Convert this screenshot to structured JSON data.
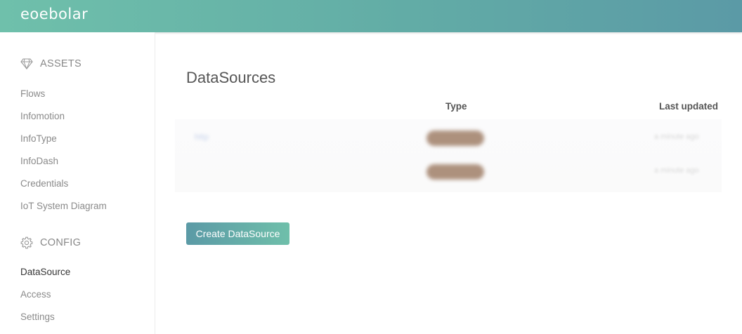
{
  "header": {
    "logo_text": "eoebolar"
  },
  "sidebar": {
    "assets_heading": "ASSETS",
    "assets_items": [
      {
        "label": "Flows"
      },
      {
        "label": "Infomotion"
      },
      {
        "label": "InfoType"
      },
      {
        "label": "InfoDash"
      },
      {
        "label": "Credentials"
      },
      {
        "label": "IoT System Diagram"
      }
    ],
    "config_heading": "CONFIG",
    "config_items": [
      {
        "label": "DataSource",
        "active": true
      },
      {
        "label": "Access"
      },
      {
        "label": "Settings"
      }
    ]
  },
  "main": {
    "title": "DataSources",
    "columns": {
      "type": "Type",
      "last_updated": "Last updated"
    },
    "rows": [
      {
        "name": "http",
        "type": "",
        "updated": "a minute ago"
      },
      {
        "name": "",
        "type": "",
        "updated": "a minute ago"
      }
    ],
    "create_button_label": "Create DataSource"
  },
  "colors": {
    "header_gradient_start": "#6fc0ab",
    "header_gradient_end": "#5b9aa6",
    "button_gradient_start": "#5b9aa6",
    "button_gradient_end": "#6fbfaa"
  },
  "icons": {
    "assets": "diamond-icon",
    "config": "gear-icon"
  }
}
